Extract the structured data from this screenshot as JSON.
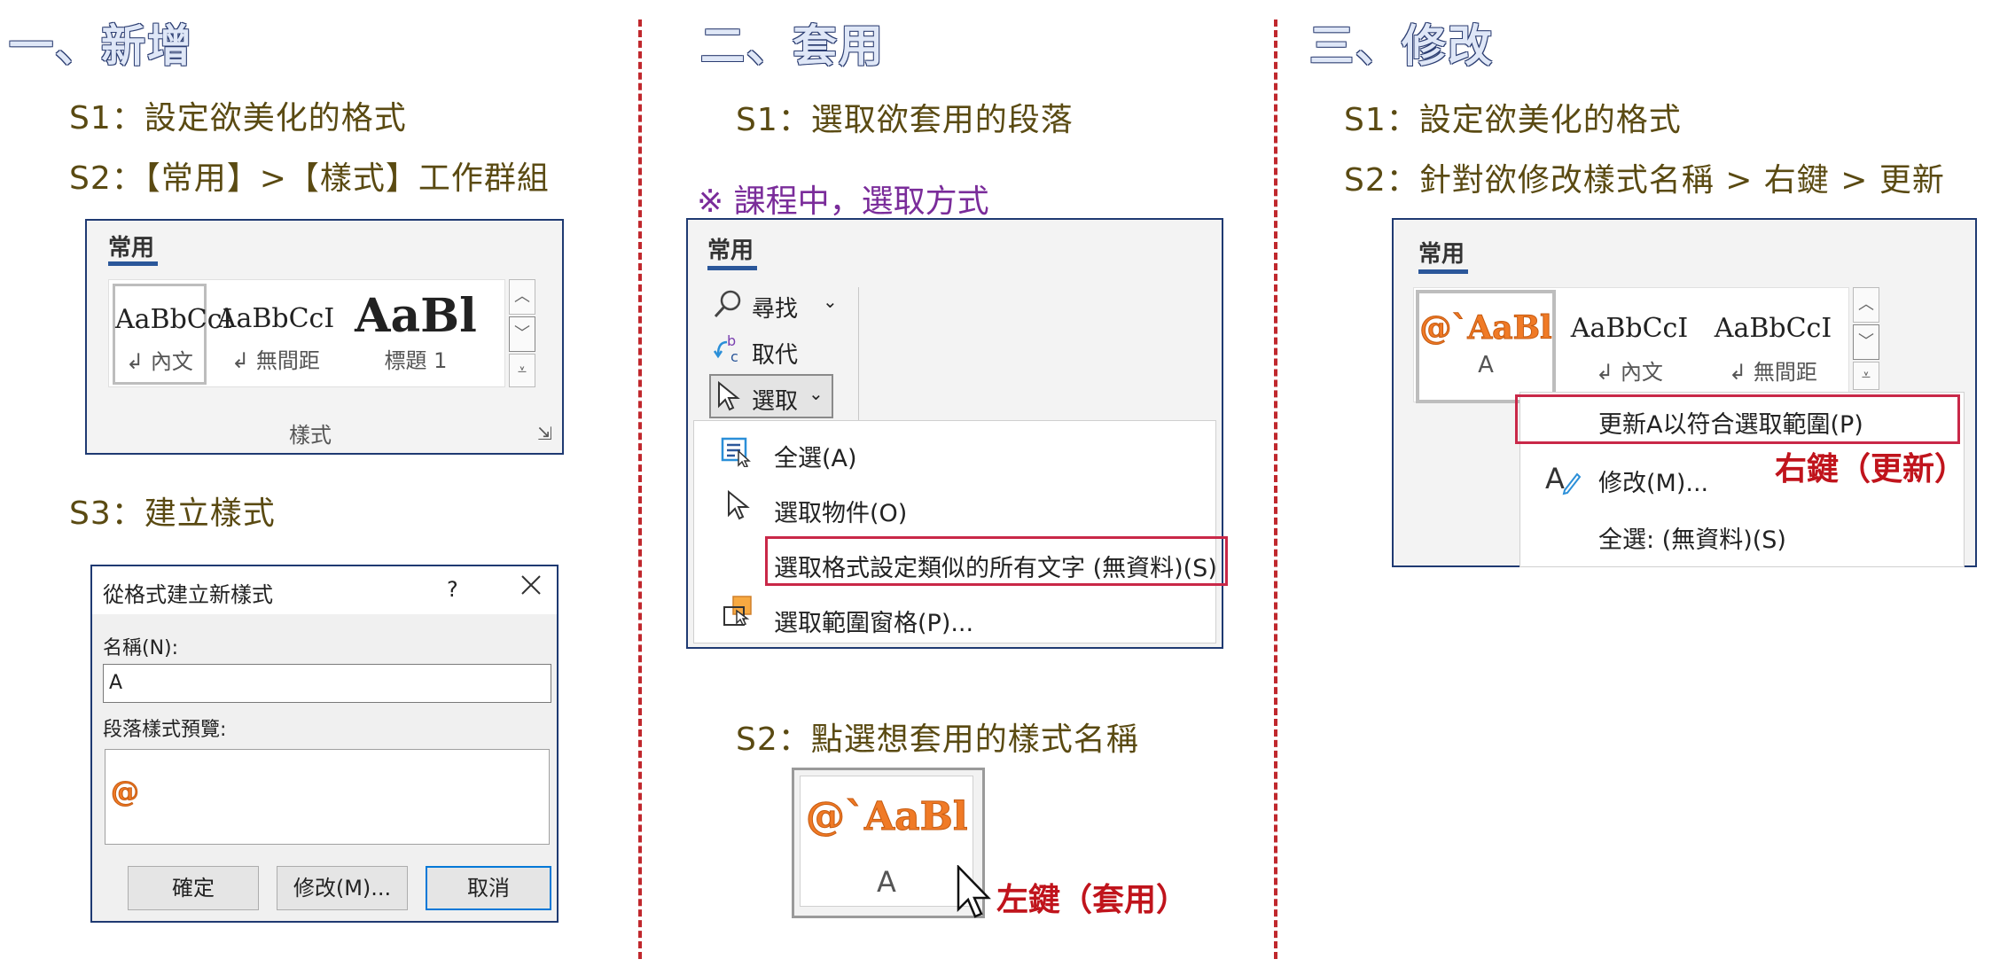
{
  "section1": {
    "title": "一、新增",
    "s1": "S1：設定欲美化的格式",
    "s2": "S2：【常用】>【樣式】工作群組",
    "ribbon": {
      "tab": "常用",
      "styles": [
        {
          "sample": "AaBbCcI",
          "label": "↲ 內文"
        },
        {
          "sample": "AaBbCcI",
          "label": "↲ 無間距"
        },
        {
          "sample": "AaBl",
          "label": "標題 1"
        }
      ],
      "group_label": "樣式"
    },
    "s3": "S3：建立樣式",
    "dialog": {
      "title": "從格式建立新樣式",
      "help": "?",
      "name_label": "名稱(N):",
      "name_value": "A",
      "preview_label": "段落樣式預覽:",
      "preview_sample": "@",
      "ok": "確定",
      "modify": "修改(M)...",
      "cancel": "取消"
    }
  },
  "section2": {
    "title": "二、套用",
    "s1": "S1：選取欲套用的段落",
    "note": "※ 課程中，選取方式",
    "ribbon": {
      "tab": "常用",
      "find": "尋找",
      "replace": "取代",
      "select": "選取",
      "menu": [
        "全選(A)",
        "選取物件(O)",
        "選取格式設定類似的所有文字 (無資料)(S)",
        "選取範圍窗格(P)..."
      ]
    },
    "s2": "S2：點選想套用的樣式名稱",
    "style_tile": {
      "sample": "@`AaBl",
      "label": "A"
    },
    "annotation": "左鍵（套用）"
  },
  "section3": {
    "title": "三、修改",
    "s1": "S1：設定欲美化的格式",
    "s2": "S2：針對欲修改樣式名稱 > 右鍵 > 更新",
    "ribbon": {
      "tab": "常用",
      "styles": [
        {
          "sample": "@`AaBl",
          "label": "A"
        },
        {
          "sample": "AaBbCcI",
          "label": "↲ 內文"
        },
        {
          "sample": "AaBbCcI",
          "label": "↲ 無間距"
        }
      ],
      "menu": [
        "更新A以符合選取範圍(P)",
        "修改(M)...",
        "全選: (無資料)(S)"
      ]
    },
    "annotation": "右鍵（更新）"
  },
  "colors": {
    "title": "#4a6aa8",
    "step": "#5a4a12",
    "note": "#7a2c9a",
    "divider": "#c0282d",
    "annotation": "#c0141c",
    "highlight": "#c92848",
    "accent": "#2b579a",
    "orange": "#f07a26"
  }
}
